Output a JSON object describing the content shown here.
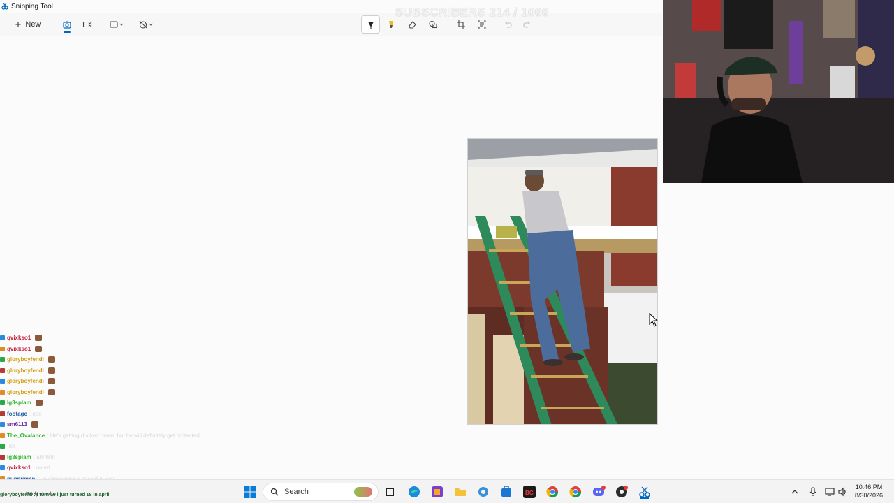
{
  "window": {
    "title": "Snipping Tool"
  },
  "toolbar": {
    "new_label": "New",
    "tools": [
      "camera-icon",
      "video-icon",
      "rect-snip-icon",
      "no-timer-icon",
      "pen-icon",
      "highlighter-icon",
      "eraser-icon",
      "shapes-icon",
      "crop-icon",
      "text-actions-icon",
      "undo-icon",
      "redo-icon"
    ]
  },
  "overlay": {
    "subscribers": "SUBSCRIBERS 214 / 1000"
  },
  "chat": {
    "rows": [
      {
        "user": "qvixkso1",
        "user_color": "#c41e3a",
        "msg": ""
      },
      {
        "user": "qvixkso1",
        "user_color": "#c41e3a",
        "msg": ""
      },
      {
        "user": "gloryboyfendi",
        "user_color": "#d4a017",
        "msg": ""
      },
      {
        "user": "gloryboyfendi",
        "user_color": "#d4a017",
        "msg": ""
      },
      {
        "user": "gloryboyfendi",
        "user_color": "#d4a017",
        "msg": ""
      },
      {
        "user": "gloryboyfendi",
        "user_color": "#d4a017",
        "msg": ""
      },
      {
        "user": "lg3splam",
        "user_color": "#2eb82e",
        "msg": ""
      },
      {
        "user": "footage",
        "user_color": "#1e5aa8",
        "msg": ": ooo"
      },
      {
        "user": "sm6113",
        "user_color": "#6b2fa3",
        "msg": ""
      },
      {
        "user": "The_Ovalance",
        "user_color": "#2eb82e",
        "msg": ": He's getting ducked down, but he will definitely get protected"
      },
      {
        "user": "",
        "user_color": "#888888",
        "msg": "lol"
      },
      {
        "user": "lg3splam",
        "user_color": "#2eb82e",
        "msg": ": ahhhhh"
      },
      {
        "user": "qvixkso1",
        "user_color": "#c41e3a",
        "msg": ": noted"
      },
      {
        "user": "puppyman",
        "user_color": "#1e5aa8",
        "msg": ": you becoming a pocket pussy"
      },
      {
        "user": "gloryboyfendi",
        "user_color": "#d4a017",
        "msg": ""
      }
    ]
  },
  "taskbar": {
    "search_placeholder": "Search",
    "weather": "Partly cloudy",
    "ticker": "gloryboyfendi : i turn 19 i just turned 18 in april",
    "time": "10:46 PM",
    "date": "8/30/2026"
  },
  "colors": {
    "accent": "#0067c0",
    "highlighter": "#e6c31a"
  }
}
